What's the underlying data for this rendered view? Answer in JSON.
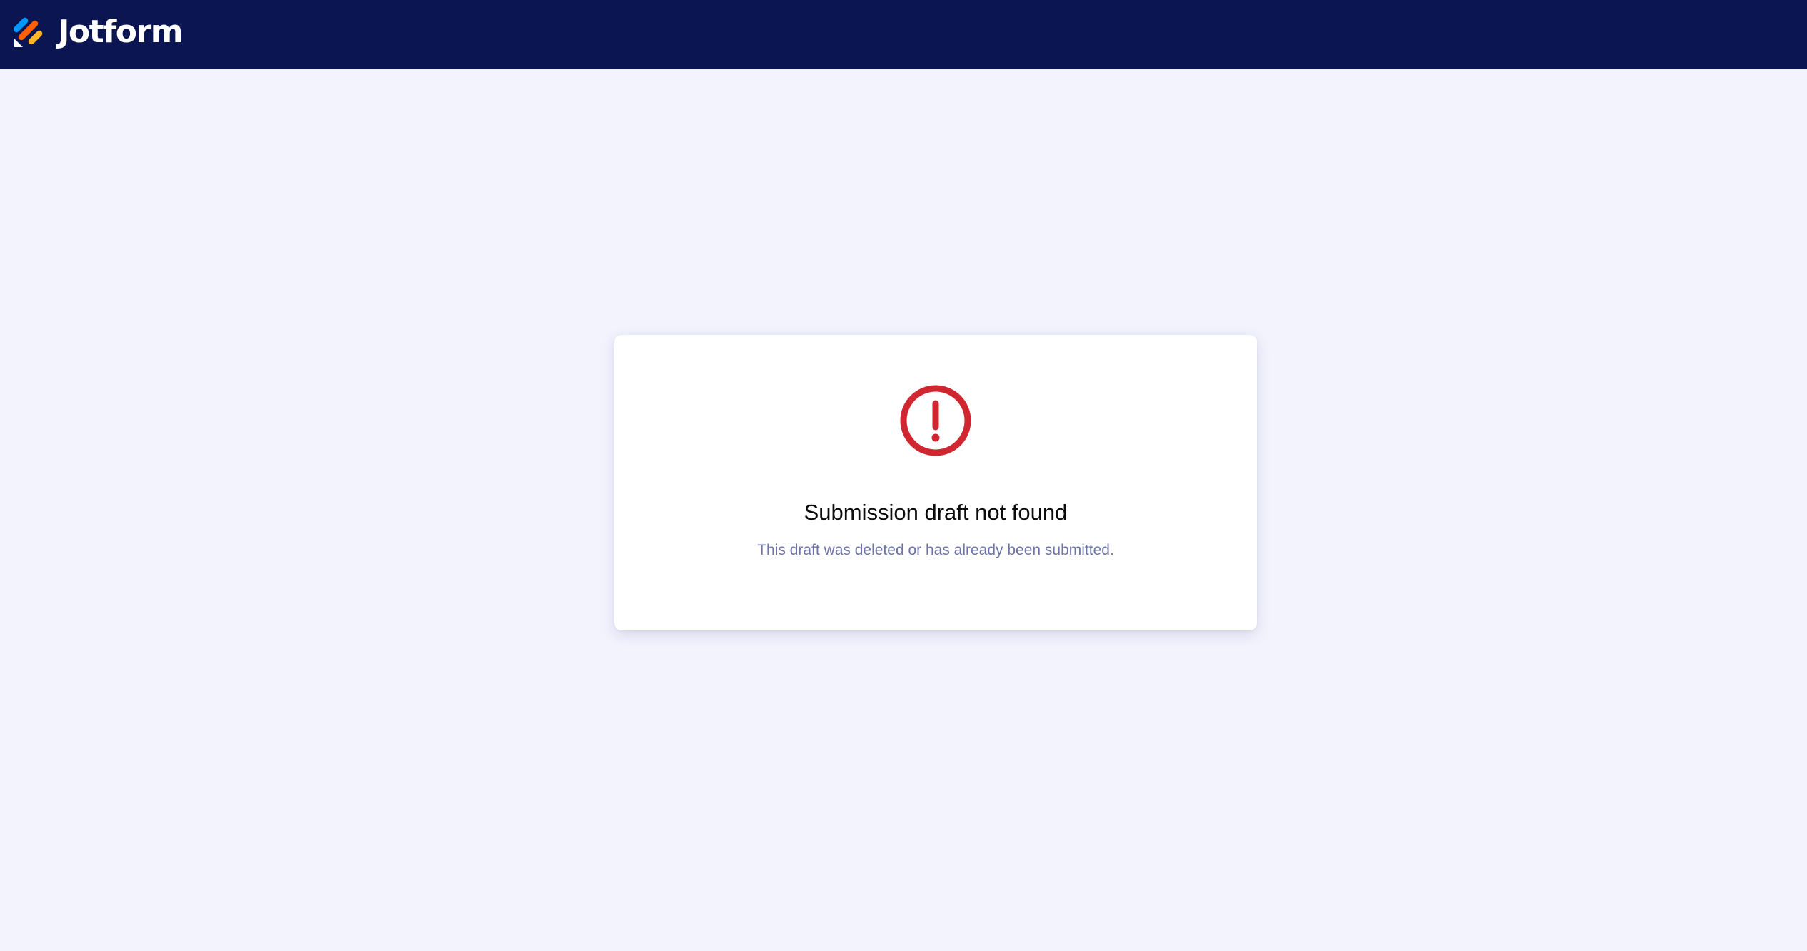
{
  "header": {
    "brand_name": "Jotform",
    "logo_icon": "jotform-logo-icon",
    "background_color": "#0a1551"
  },
  "message": {
    "icon": "alert-circle-icon",
    "icon_color": "#d0262f",
    "title": "Submission draft not found",
    "description": "This draft was deleted or has already been submitted."
  },
  "colors": {
    "page_background": "#f3f3fe",
    "card_background": "#ffffff",
    "description_text": "#6c73a8"
  }
}
